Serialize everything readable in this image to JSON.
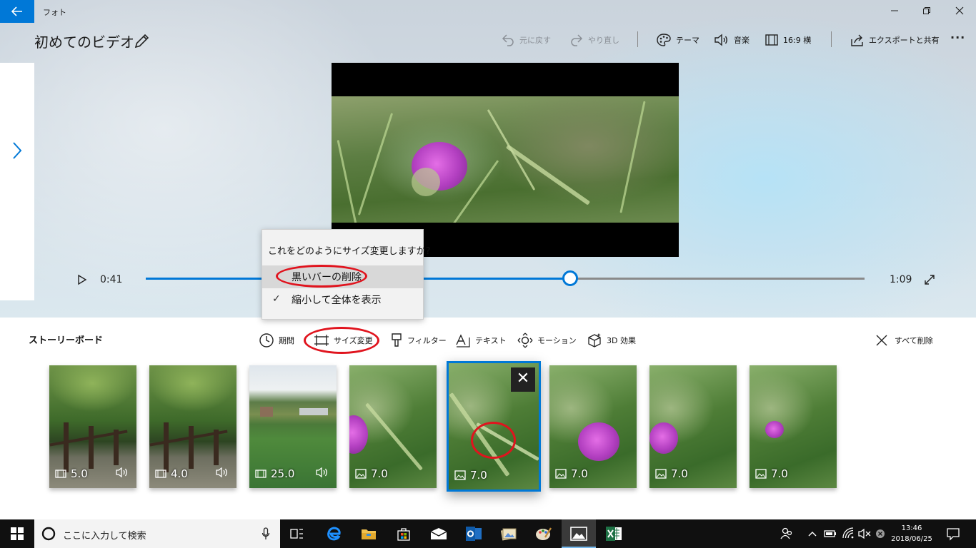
{
  "app": {
    "name": "フォト",
    "back_icon": "back-arrow-icon"
  },
  "window_controls": {
    "minimize": "—",
    "maximize": "❐",
    "close": "✕"
  },
  "project": {
    "title": "初めてのビデオ"
  },
  "toolbar": {
    "undo": "元に戻す",
    "redo": "やり直し",
    "theme": "テーマ",
    "music": "音楽",
    "aspect": "16:9 横",
    "export": "エクスポートと共有",
    "more": "···"
  },
  "playback": {
    "current": "0:41",
    "total": "1:09",
    "progress_fraction": 0.59
  },
  "resize_flyout": {
    "question": "これをどのようにサイズ変更しますか?",
    "options": [
      {
        "label": "黒いバーの削除",
        "selected": true,
        "checked": false
      },
      {
        "label": "縮小して全体を表示",
        "selected": false,
        "checked": true
      }
    ]
  },
  "storyboard": {
    "title": "ストーリーボード",
    "tools": {
      "duration": "期間",
      "resize": "サイズ変更",
      "filter": "フィルター",
      "text": "テキスト",
      "motion": "モーション",
      "effects3d": "3D 効果"
    },
    "clear_all": "すべて削除",
    "clips": [
      {
        "duration": "5.0",
        "kind": "video",
        "audio": true,
        "selected": false
      },
      {
        "duration": "4.0",
        "kind": "video",
        "audio": true,
        "selected": false
      },
      {
        "duration": "25.0",
        "kind": "video",
        "audio": true,
        "selected": false
      },
      {
        "duration": "7.0",
        "kind": "photo",
        "audio": false,
        "selected": false
      },
      {
        "duration": "7.0",
        "kind": "photo",
        "audio": false,
        "selected": true
      },
      {
        "duration": "7.0",
        "kind": "photo",
        "audio": false,
        "selected": false
      },
      {
        "duration": "7.0",
        "kind": "photo",
        "audio": false,
        "selected": false
      },
      {
        "duration": "7.0",
        "kind": "photo",
        "audio": false,
        "selected": false
      }
    ],
    "clip_close": "✕"
  },
  "taskbar": {
    "search_placeholder": "ここに入力して検索",
    "time": "13:46",
    "date": "2018/06/25"
  },
  "colors": {
    "accent": "#0078d7",
    "annotation": "#e0141e",
    "taskbar": "#101010"
  }
}
